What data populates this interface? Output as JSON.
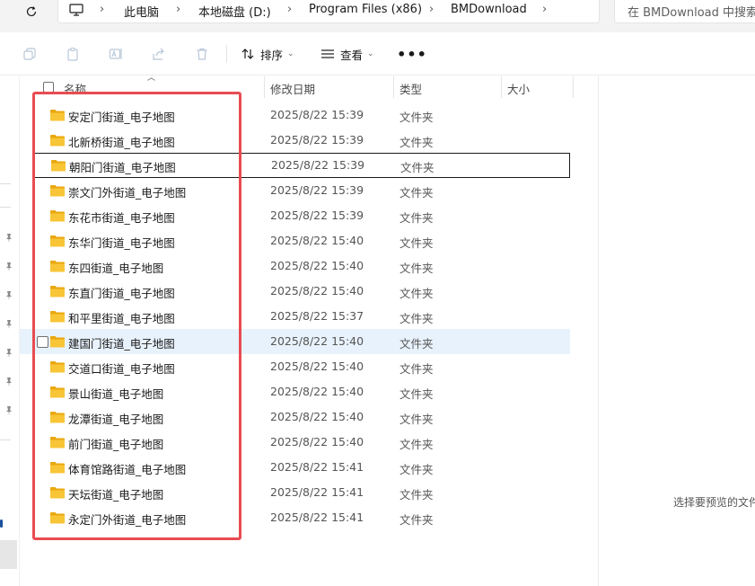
{
  "address_bar": {
    "breadcrumbs": [
      "此电脑",
      "本地磁盘 (D:)",
      "Program Files (x86)",
      "BMDownload"
    ],
    "search_placeholder": "在 BMDownload 中搜索"
  },
  "commands": {
    "sort_label": "排序",
    "view_label": "查看",
    "more_label": "•••"
  },
  "columns": {
    "name": "名称",
    "date_modified": "修改日期",
    "type": "类型",
    "size": "大小"
  },
  "files": [
    {
      "name": "安定门街道_电子地图",
      "date": "2025/8/22 15:39",
      "type": "文件夹"
    },
    {
      "name": "北新桥街道_电子地图",
      "date": "2025/8/22 15:39",
      "type": "文件夹"
    },
    {
      "name": "朝阳门街道_电子地图",
      "date": "2025/8/22 15:39",
      "type": "文件夹"
    },
    {
      "name": "崇文门外街道_电子地图",
      "date": "2025/8/22 15:39",
      "type": "文件夹"
    },
    {
      "name": "东花市街道_电子地图",
      "date": "2025/8/22 15:39",
      "type": "文件夹"
    },
    {
      "name": "东华门街道_电子地图",
      "date": "2025/8/22 15:40",
      "type": "文件夹"
    },
    {
      "name": "东四街道_电子地图",
      "date": "2025/8/22 15:40",
      "type": "文件夹"
    },
    {
      "name": "东直门街道_电子地图",
      "date": "2025/8/22 15:40",
      "type": "文件夹"
    },
    {
      "name": "和平里街道_电子地图",
      "date": "2025/8/22 15:37",
      "type": "文件夹"
    },
    {
      "name": "建国门街道_电子地图",
      "date": "2025/8/22 15:40",
      "type": "文件夹"
    },
    {
      "name": "交道口街道_电子地图",
      "date": "2025/8/22 15:40",
      "type": "文件夹"
    },
    {
      "name": "景山街道_电子地图",
      "date": "2025/8/22 15:40",
      "type": "文件夹"
    },
    {
      "name": "龙潭街道_电子地图",
      "date": "2025/8/22 15:40",
      "type": "文件夹"
    },
    {
      "name": "前门街道_电子地图",
      "date": "2025/8/22 15:40",
      "type": "文件夹"
    },
    {
      "name": "体育馆路街道_电子地图",
      "date": "2025/8/22 15:41",
      "type": "文件夹"
    },
    {
      "name": "天坛街道_电子地图",
      "date": "2025/8/22 15:41",
      "type": "文件夹"
    },
    {
      "name": "永定门外街道_电子地图",
      "date": "2025/8/22 15:41",
      "type": "文件夹"
    }
  ],
  "focused_row_index": 2,
  "hovered_row_index": 9,
  "preview": {
    "message": "选择要预览的文件。"
  },
  "colors": {
    "highlight_box": "#e84c52",
    "folder": "#f8c537",
    "hover_row": "#e8f2fc"
  }
}
